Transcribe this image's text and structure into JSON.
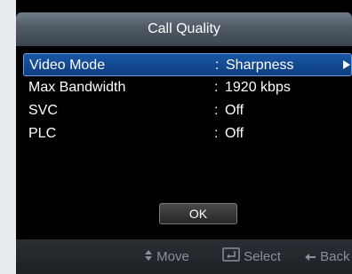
{
  "window": {
    "title": "Call Quality"
  },
  "settings": [
    {
      "label": "Video Mode",
      "colon": ":",
      "value": "Sharpness"
    },
    {
      "label": "Max Bandwidth",
      "colon": ":",
      "value": "1920 kbps"
    },
    {
      "label": "SVC",
      "colon": ":",
      "value": "Off"
    },
    {
      "label": "PLC",
      "colon": ":",
      "value": "Off"
    }
  ],
  "ok_label": "OK",
  "footer": {
    "move": "Move",
    "select": "Select",
    "back": "Back"
  },
  "icons": {
    "selected_arrow": "right-triangle-icon",
    "move": "up-down-arrows-icon",
    "select": "enter-key-icon",
    "back": "left-arrow-icon"
  },
  "colors": {
    "title_bar": "#55616c",
    "selection": "#134b94",
    "footer_text": "#8b9097"
  }
}
